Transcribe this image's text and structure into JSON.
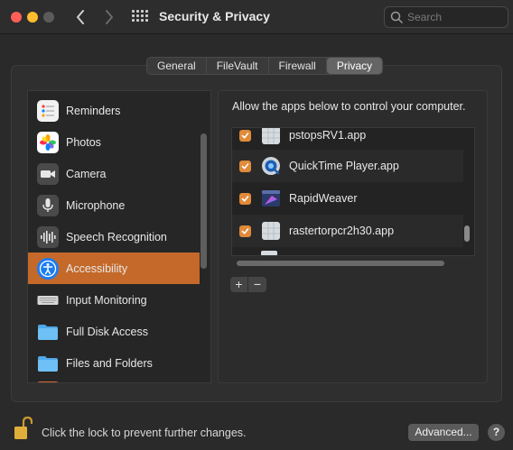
{
  "window": {
    "title": "Security & Privacy",
    "search_placeholder": "Search"
  },
  "tabs": [
    {
      "label": "General",
      "active": false
    },
    {
      "label": "FileVault",
      "active": false
    },
    {
      "label": "Firewall",
      "active": false
    },
    {
      "label": "Privacy",
      "active": true
    }
  ],
  "sidebar": {
    "items": [
      {
        "label": "Reminders",
        "icon": "reminders-icon"
      },
      {
        "label": "Photos",
        "icon": "photos-icon"
      },
      {
        "label": "Camera",
        "icon": "camera-icon"
      },
      {
        "label": "Microphone",
        "icon": "microphone-icon"
      },
      {
        "label": "Speech Recognition",
        "icon": "speech-recognition-icon"
      },
      {
        "label": "Accessibility",
        "icon": "accessibility-icon",
        "selected": true
      },
      {
        "label": "Input Monitoring",
        "icon": "keyboard-icon"
      },
      {
        "label": "Full Disk Access",
        "icon": "folder-icon"
      },
      {
        "label": "Files and Folders",
        "icon": "folder-icon"
      }
    ]
  },
  "main": {
    "allow_text": "Allow the apps below to control your computer.",
    "apps": [
      {
        "name": "pstopsRV1.app",
        "checked": true,
        "icon": "generic-app-icon"
      },
      {
        "name": "QuickTime Player.app",
        "checked": true,
        "icon": "quicktime-icon"
      },
      {
        "name": "RapidWeaver",
        "checked": true,
        "icon": "rapidweaver-icon"
      },
      {
        "name": "rastertorpcr2h30.app",
        "checked": true,
        "icon": "generic-app-icon"
      }
    ],
    "add_label": "+",
    "remove_label": "−"
  },
  "footer": {
    "lock_text": "Click the lock to prevent further changes.",
    "advanced_label": "Advanced...",
    "help_label": "?"
  },
  "colors": {
    "accent": "#c4692a",
    "checkbox": "#e08a3a"
  }
}
